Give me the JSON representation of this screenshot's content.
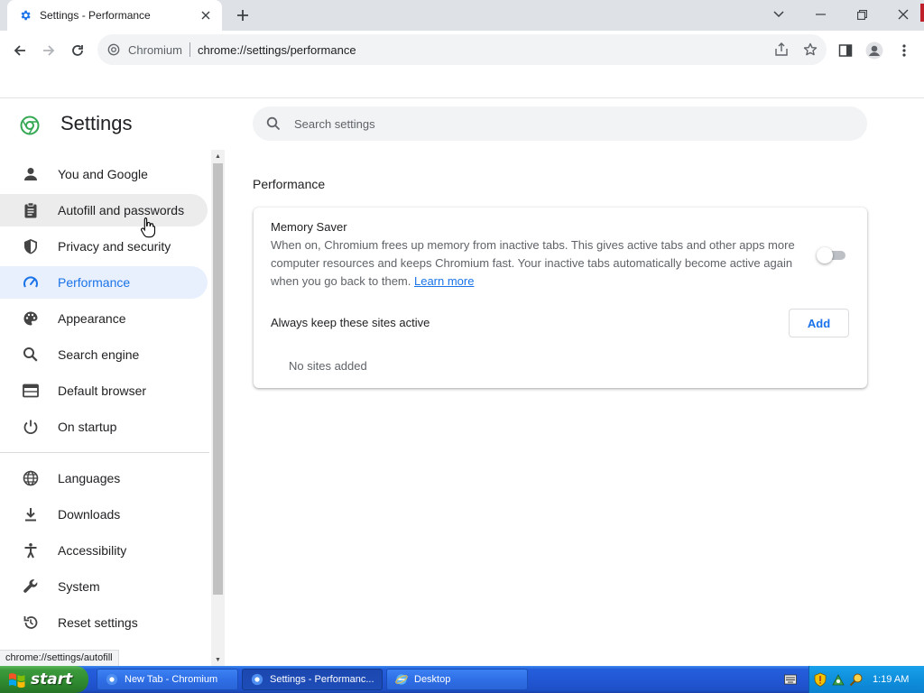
{
  "browser": {
    "tab_title": "Settings - Performance",
    "omnibox": {
      "site_name": "Chromium",
      "url": "chrome://settings/performance"
    }
  },
  "settings": {
    "title": "Settings",
    "search_placeholder": "Search settings",
    "nav": [
      {
        "label": "You and Google",
        "icon": "person-icon"
      },
      {
        "label": "Autofill and passwords",
        "icon": "clipboard-icon",
        "state": "hover"
      },
      {
        "label": "Privacy and security",
        "icon": "shield-icon"
      },
      {
        "label": "Performance",
        "icon": "speedometer-icon",
        "state": "active"
      },
      {
        "label": "Appearance",
        "icon": "palette-icon"
      },
      {
        "label": "Search engine",
        "icon": "search-icon"
      },
      {
        "label": "Default browser",
        "icon": "browser-window-icon"
      },
      {
        "label": "On startup",
        "icon": "power-icon"
      },
      {
        "label": "Languages",
        "icon": "globe-icon"
      },
      {
        "label": "Downloads",
        "icon": "download-icon"
      },
      {
        "label": "Accessibility",
        "icon": "accessibility-icon"
      },
      {
        "label": "System",
        "icon": "wrench-icon"
      },
      {
        "label": "Reset settings",
        "icon": "reset-icon"
      }
    ],
    "status_url": "chrome://settings/autofill"
  },
  "performance": {
    "section_title": "Performance",
    "memory_saver": {
      "title": "Memory Saver",
      "description": "When on, Chromium frees up memory from inactive tabs. This gives active tabs and other apps more computer resources and keeps Chromium fast. Your inactive tabs automatically become active again when you go back to them. ",
      "learn_more": "Learn more",
      "enabled": false
    },
    "keep_active": {
      "title": "Always keep these sites active",
      "add_label": "Add",
      "empty_text": "No sites added"
    }
  },
  "taskbar": {
    "start_label": "start",
    "tasks": [
      {
        "label": "New Tab - Chromium",
        "active": false
      },
      {
        "label": "Settings - Performanc...",
        "active": true
      },
      {
        "label": "Desktop",
        "active": false
      }
    ],
    "clock": "1:19 AM"
  },
  "colors": {
    "accent": "#1a73e8",
    "active_nav_bg": "#e8f0fe",
    "taskbar_blue": "#245edb",
    "start_green": "#3c9a3c"
  }
}
